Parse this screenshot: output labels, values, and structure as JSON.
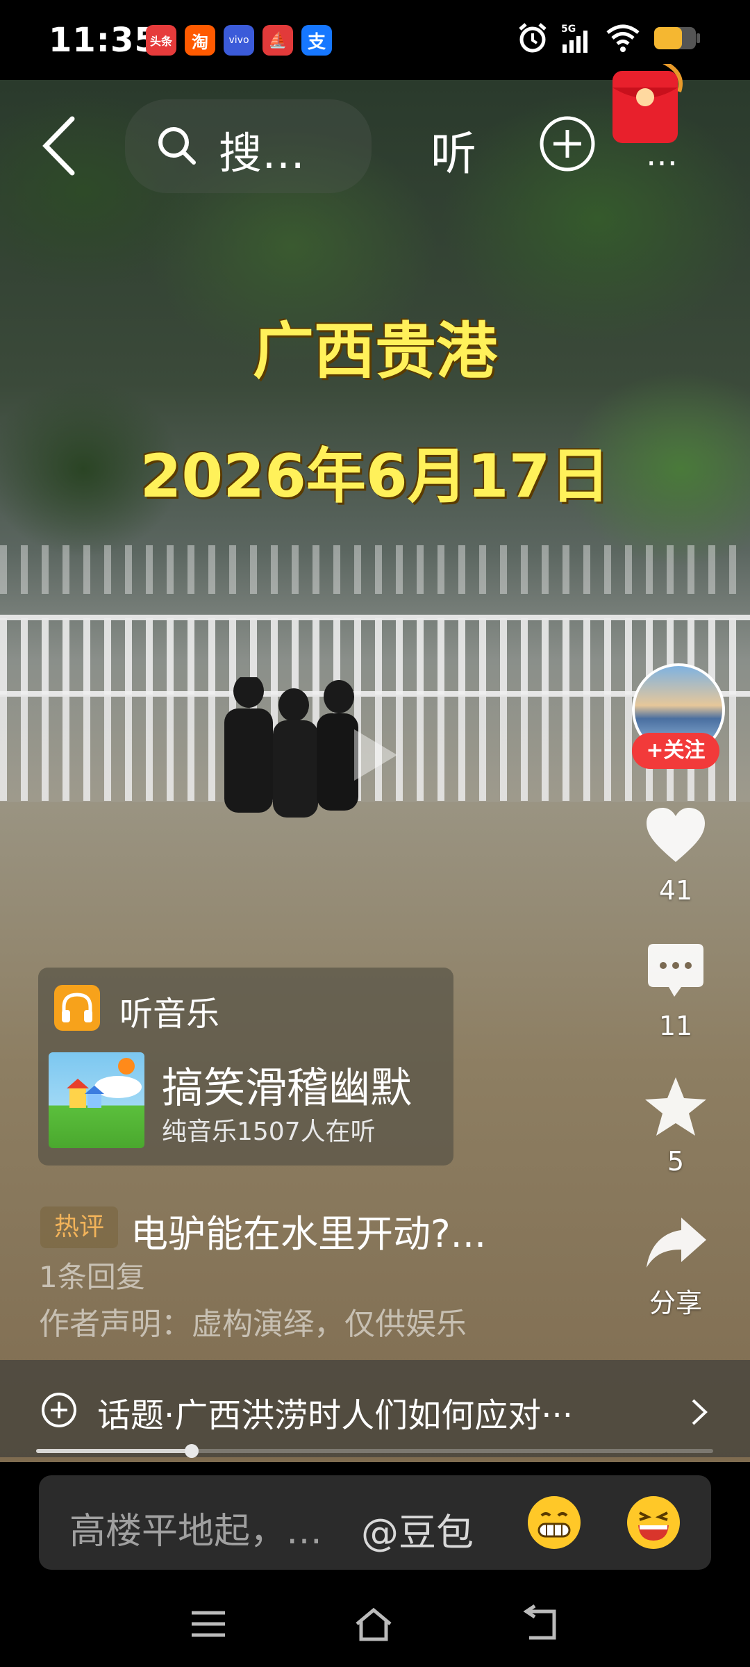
{
  "status_bar": {
    "time": "11:35",
    "apps": [
      {
        "label": "头条",
        "icon": "toutiao-icon",
        "color": "#e63b3b"
      },
      {
        "label": "淘",
        "icon": "taobao-icon",
        "color": "#ff5a00"
      },
      {
        "label": "vivo",
        "icon": "vivo-icon",
        "color": "#3b5bd9"
      },
      {
        "label": "⛵",
        "icon": "securities-icon",
        "color": "#e23a3a"
      },
      {
        "label": "支",
        "icon": "alipay-icon",
        "color": "#1677ff"
      }
    ],
    "network": "5G"
  },
  "top_bar": {
    "search_text": "搜…",
    "listen_label": "听",
    "more_label": "…"
  },
  "video": {
    "location_text": "广西贵港",
    "date_text": "2026年6月17日"
  },
  "right_rail": {
    "follow_label": "+关注",
    "likes": "41",
    "comments": "11",
    "favorites": "5",
    "share_label": "分享"
  },
  "music_card": {
    "label": "听音乐",
    "title": "搞笑滑稽幽默",
    "subtitle": "纯音乐1507人在听"
  },
  "comment": {
    "badge": "热评",
    "text": "电驴能在水里开动?...",
    "replies": "1条回复",
    "declaration": "作者声明：虚构演绎，仅供娱乐"
  },
  "topic": {
    "text": "话题·广西洪涝时人们如何应对···"
  },
  "playback": {
    "progress": 0.23
  },
  "input": {
    "placeholder": "高楼平地起，…",
    "mention": "@豆包"
  }
}
